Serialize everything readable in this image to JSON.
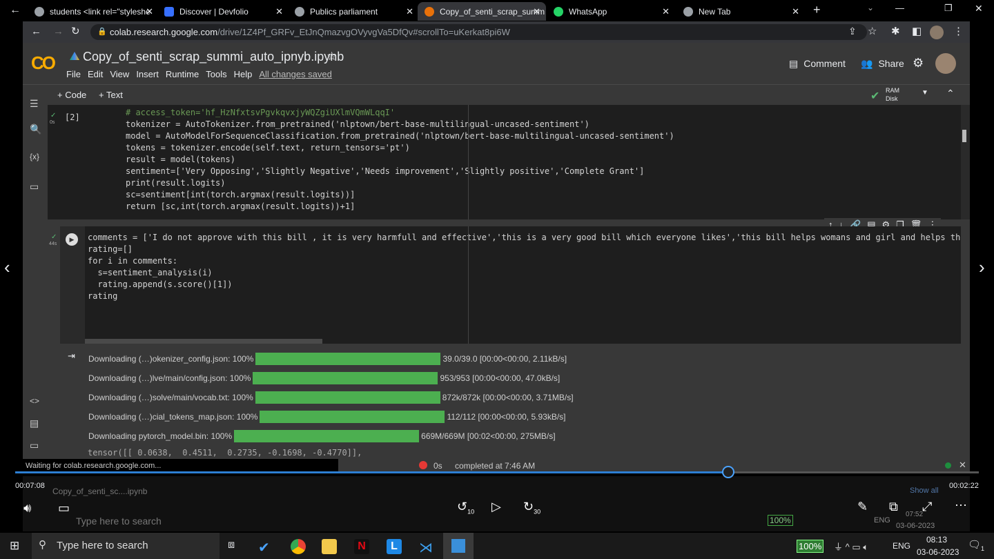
{
  "browser": {
    "tabs": [
      {
        "label": "students <link rel=\"styleshe",
        "active": false
      },
      {
        "label": "Discover | Devfolio",
        "active": false
      },
      {
        "label": "Publics parliament",
        "active": false
      },
      {
        "label": "Copy_of_senti_scrap_summ",
        "active": true
      },
      {
        "label": "WhatsApp",
        "active": false
      },
      {
        "label": "New Tab",
        "active": false
      }
    ],
    "url_host": "colab.research.google.com",
    "url_path": "/drive/1Z4Pf_GRFv_EtJnQmazvgOVyvgVa5DfQv#scrollTo=uKerkat8pi6W"
  },
  "colab": {
    "logo": "CO",
    "title": "Copy_of_senti_scrap_summi_auto_ipnyb.ipynb",
    "menu": [
      "File",
      "Edit",
      "View",
      "Insert",
      "Runtime",
      "Tools",
      "Help"
    ],
    "saved": "All changes saved",
    "comment": "Comment",
    "share": "Share",
    "add_code": "+ Code",
    "add_text": "+ Text",
    "ram": "RAM",
    "disk": "Disk",
    "accent": "#f9ab00"
  },
  "cell1": {
    "exec": "[2]",
    "time": "0s",
    "lines": [
      "# access_token='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'",
      "tokenizer = AutoTokenizer.from_pretrained('nlptown/bert-base-multilingual-uncased-sentiment')",
      "model = AutoModelForSequenceClassification.from_pretrained('nlptown/bert-base-multilingual-uncased-sentiment')",
      "tokens = tokenizer.encode(self.text, return_tensors='pt')",
      "result = model(tokens)",
      "sentiment=['Very Opposing','Slightly Negative','Needs improvement','Slightly positive','Complete Grant']",
      "print(result.logits)",
      "sc=sentiment[int(torch.argmax(result.logits))]",
      "return [sc,int(torch.argmax(result.logits))+1]"
    ]
  },
  "cell2": {
    "time": "44s",
    "lines": [
      "",
      "comments = ['I do not approve with this bill , it is very harmfull and effective','this is a very good bill which everyone likes','this bill helps womans and girl and helps them impro",
      "rating=[]",
      "for i in comments:",
      "  s=sentiment_analysis(i)",
      "  rating.append(s.score()[1])",
      "",
      "rating"
    ]
  },
  "output": {
    "downloads": [
      {
        "label": "Downloading (…)okenizer_config.json: 100%",
        "progress": 100,
        "info": "39.0/39.0 [00:00<00:00, 2.11kB/s]"
      },
      {
        "label": "Downloading (…)lve/main/config.json: 100%",
        "progress": 100,
        "info": "953/953 [00:00<00:00, 47.0kB/s]"
      },
      {
        "label": "Downloading (…)solve/main/vocab.txt: 100%",
        "progress": 100,
        "info": "872k/872k [00:00<00:00, 3.71MB/s]"
      },
      {
        "label": "Downloading (…)cial_tokens_map.json: 100%",
        "progress": 100,
        "info": "112/112 [00:00<00:00, 5.93kB/s]"
      },
      {
        "label": "Downloading pytorch_model.bin: 100%",
        "progress": 100,
        "info": "669M/669M [00:02<00:00, 275MB/s]"
      }
    ],
    "tensor": "tensor([[ 0.0638,  0.4511,  0.2735, -0.1698, -0.4770]],"
  },
  "status": {
    "waiting": "Waiting for colab.research.google.com...",
    "time": "0s",
    "completed": "completed at 7:46 AM"
  },
  "player": {
    "elapsed": "00:07:08",
    "remaining": "00:02:22",
    "progress_percent": 74,
    "download_file": "Copy_of_senti_sc....ipynb",
    "show_all": "Show all",
    "rewind": "10",
    "forward": "30"
  },
  "recorded_taskbar": {
    "search": "Type here to search",
    "battery": "100%",
    "lang": "ENG",
    "time": "07:52",
    "date": "03-06-2023"
  },
  "taskbar": {
    "search": "Type here to search",
    "battery": "100%",
    "lang": "ENG",
    "time": "08:13",
    "date": "03-06-2023",
    "notifications": "1"
  }
}
